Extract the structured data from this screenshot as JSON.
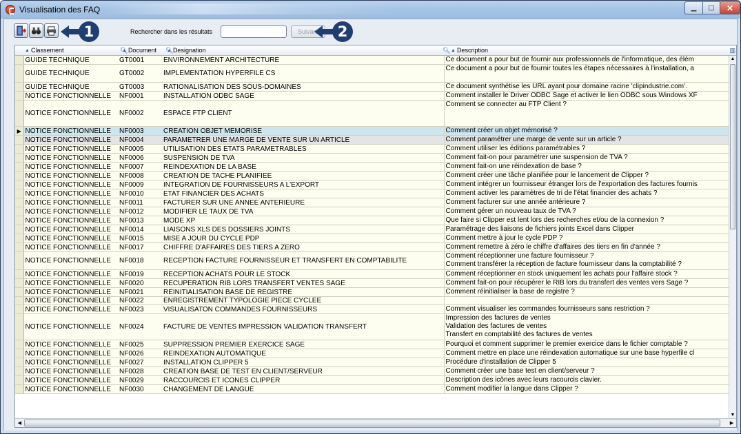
{
  "window": {
    "title": "Visualisation des FAQ"
  },
  "toolbar": {
    "buttons": [
      {
        "icon": "exit-door-icon"
      },
      {
        "icon": "binoculars-icon"
      },
      {
        "icon": "printer-icon"
      }
    ],
    "callout1": "1",
    "callout2": "2",
    "search_label": "Rechercher dans les résultats",
    "search_value": "",
    "next_label": "Suivant"
  },
  "grid": {
    "columns": [
      "Classement",
      "Document",
      "Designation",
      "Description"
    ],
    "rows": [
      {
        "classement": "GUIDE TECHNIQUE",
        "document": "GT0001",
        "designation": "ENVIRONNEMENT ARCHITECTURE",
        "description": [
          "Ce document a pour but de fournir aux professionnels de l'informatique, des élém"
        ]
      },
      {
        "classement": "GUIDE TECHNIQUE",
        "document": "GT0002",
        "designation": "IMPLEMENTATION HYPERFILE CS",
        "description": [
          "Ce document a pour but de fournir toutes les étapes nécessaires à l'installation, a",
          ""
        ]
      },
      {
        "classement": "GUIDE TECHNIQUE",
        "document": "GT0003",
        "designation": "RATIONALISATION DES SOUS-DOMAINES",
        "description": [
          "Ce document synthétise les URL ayant pour domaine racine 'clipindustrie.com'."
        ]
      },
      {
        "classement": "NOTICE FONCTIONNELLE",
        "document": "NF0001",
        "designation": "INSTALLATION ODBC SAGE",
        "description": [
          "Comment installer le Driver ODBC Sage et activer le lien ODBC sous Windows XF"
        ]
      },
      {
        "classement": "NOTICE FONCTIONNELLE",
        "document": "NF0002",
        "designation": "ESPACE FTP CLIENT",
        "description": [
          "Comment se connecter au FTP Client ?",
          "",
          ""
        ]
      },
      {
        "classement": "NOTICE FONCTIONNELLE",
        "document": "NF0003",
        "designation": "CREATION OBJET MEMORISE",
        "description": [
          "Comment créer un objet mémorisé ?"
        ],
        "state": "selected"
      },
      {
        "classement": "NOTICE FONCTIONNELLE",
        "document": "NF0004",
        "designation": "PARAMETRER UNE MARGE DE VENTE SUR UN ARTICLE",
        "description": [
          "Comment paramétrer une marge de vente sur un article ?"
        ],
        "state": "hover"
      },
      {
        "classement": "NOTICE FONCTIONNELLE",
        "document": "NF0005",
        "designation": "UTILISATION DES ETATS PARAMETRABLES",
        "description": [
          "Comment utiliser les éditions paramétrables ?"
        ]
      },
      {
        "classement": "NOTICE FONCTIONNELLE",
        "document": "NF0006",
        "designation": "SUSPENSION DE TVA",
        "description": [
          "Comment fait-on pour paramétrer une suspension de TVA ?"
        ]
      },
      {
        "classement": "NOTICE FONCTIONNELLE",
        "document": "NF0007",
        "designation": "REINDEXATION DE LA BASE",
        "description": [
          "Comment fait-on une réindexation de base ?"
        ]
      },
      {
        "classement": "NOTICE FONCTIONNELLE",
        "document": "NF0008",
        "designation": "CREATION DE TACHE PLANIFIEE",
        "description": [
          "Comment créer une tâche planifiée pour le lancement de Clipper ?"
        ]
      },
      {
        "classement": "NOTICE FONCTIONNELLE",
        "document": "NF0009",
        "designation": "INTEGRATION DE FOURNISSEURS A L'EXPORT",
        "description": [
          "Comment intégrer un fournisseur étranger lors de l'exportation des factures fournis"
        ]
      },
      {
        "classement": "NOTICE FONCTIONNELLE",
        "document": "NF0010",
        "designation": "ETAT FINANCIER DES ACHATS",
        "description": [
          "Comment activer les paramètres de tri de l'état financier des achats ?"
        ]
      },
      {
        "classement": "NOTICE FONCTIONNELLE",
        "document": "NF0011",
        "designation": "FACTURER SUR UNE ANNEE ANTERIEURE",
        "description": [
          "Comment facturer sur une année antérieure ?"
        ]
      },
      {
        "classement": "NOTICE FONCTIONNELLE",
        "document": "NF0012",
        "designation": "MODIFIER LE TAUX DE TVA",
        "description": [
          "Comment gérer un nouveau taux de TVA ?"
        ]
      },
      {
        "classement": "NOTICE FONCTIONNELLE",
        "document": "NF0013",
        "designation": "MODE XP",
        "description": [
          "Que faire si Clipper est lent lors des recherches et/ou de la connexion ?"
        ]
      },
      {
        "classement": "NOTICE FONCTIONNELLE",
        "document": "NF0014",
        "designation": "LIAISONS XLS DES DOSSIERS JOINTS",
        "description": [
          "Paramétrage des liaisons de fichiers joints Excel dans Clipper"
        ]
      },
      {
        "classement": "NOTICE FONCTIONNELLE",
        "document": "NF0015",
        "designation": "MISE A JOUR DU CYCLE PDP",
        "description": [
          "Comment mettre à jour le cycle PDP ?"
        ]
      },
      {
        "classement": "NOTICE FONCTIONNELLE",
        "document": "NF0017",
        "designation": "CHIFFRE D'AFFAIRES DES TIERS A ZERO",
        "description": [
          "Comment remettre à zéro le chiffre d'affaires des tiers en fin d'année ?"
        ]
      },
      {
        "classement": "NOTICE FONCTIONNELLE",
        "document": "NF0018",
        "designation": "RECEPTION FACTURE FOURNISSEUR ET TRANSFERT EN COMPTABILITE",
        "description": [
          "Comment réceptionner une facture fournisseur ?",
          "Comment transférer la réception de facture fournisseur dans la comptabilité ?"
        ]
      },
      {
        "classement": "NOTICE FONCTIONNELLE",
        "document": "NF0019",
        "designation": "RECEPTION ACHATS POUR LE STOCK",
        "description": [
          "Comment réceptionner en stock uniquement les achats pour l'affaire stock ?"
        ]
      },
      {
        "classement": "NOTICE FONCTIONNELLE",
        "document": "NF0020",
        "designation": "RECUPERATION RIB LORS TRANSFERT VENTES SAGE",
        "description": [
          "Comment fait-on pour récupérer le RIB lors du transfert des ventes vers Sage ?"
        ]
      },
      {
        "classement": "NOTICE FONCTIONNELLE",
        "document": "NF0021",
        "designation": "REINITIALISATION BASE DE REGISTRE",
        "description": [
          "Comment réinitialiser la base de registre ?"
        ]
      },
      {
        "classement": "NOTICE FONCTIONNELLE",
        "document": "NF0022",
        "designation": "ENREGISTREMENT TYPOLOGIE PIECE CYCLEE",
        "description": [
          ""
        ]
      },
      {
        "classement": "NOTICE FONCTIONNELLE",
        "document": "NF0023",
        "designation": "VISUALISATON COMMANDES FOURNISSEURS",
        "description": [
          "Comment visualiser les commandes fournisseurs sans restriction ?"
        ]
      },
      {
        "classement": "NOTICE FONCTIONNELLE",
        "document": "NF0024",
        "designation": "FACTURE DE VENTES IMPRESSION  VALIDATION TRANSFERT",
        "description": [
          "Impression des factures de ventes",
          "Validation des factures de ventes",
          "Transfert en comptabilité des factures de ventes"
        ]
      },
      {
        "classement": "NOTICE FONCTIONNELLE",
        "document": "NF0025",
        "designation": "SUPPRESSION PREMIER EXERCICE SAGE",
        "description": [
          "Pourquoi et comment supprimer le premier exercice dans le fichier comptable ?"
        ]
      },
      {
        "classement": "NOTICE FONCTIONNELLE",
        "document": "NF0026",
        "designation": "REINDEXATION AUTOMATIQUE",
        "description": [
          "Comment mettre en place une réindexation automatique sur une base hyperfile cl"
        ]
      },
      {
        "classement": "NOTICE FONCTIONNELLE",
        "document": "NF0027",
        "designation": "INSTALLATION CLIPPER 5",
        "description": [
          "Procédure d'installation de Clipper 5"
        ]
      },
      {
        "classement": "NOTICE FONCTIONNELLE",
        "document": "NF0028",
        "designation": "CREATION BASE DE TEST EN CLIENT/SERVEUR",
        "description": [
          "Comment créer une base test en client/serveur ?"
        ]
      },
      {
        "classement": "NOTICE FONCTIONNELLE",
        "document": "NF0029",
        "designation": "RACCOURCIS ET ICONES CLIPPER",
        "description": [
          "Description des icônes avec leurs racourcis clavier."
        ]
      },
      {
        "classement": "NOTICE FONCTIONNELLE",
        "document": "NF0030",
        "designation": "CHANGEMENT DE LANGUE",
        "description": [
          "Comment modifier la langue dans Clipper ?"
        ]
      }
    ]
  }
}
